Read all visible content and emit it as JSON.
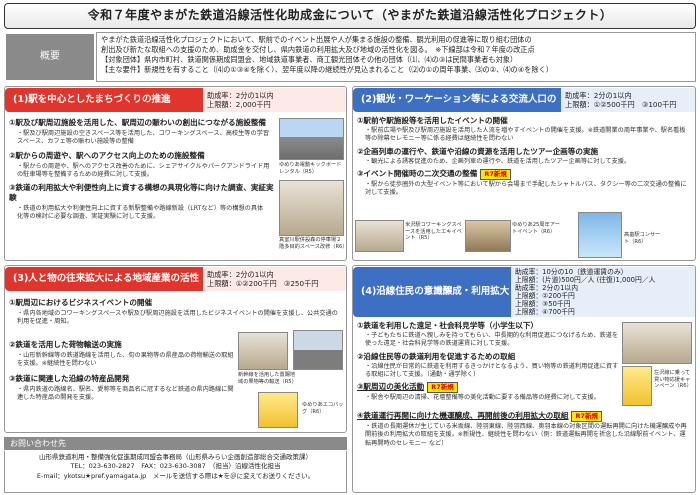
{
  "title": "令和７年度やまがた鉄道沿線活性化助成金について（やまがた鉄道沿線活性化プロジェクト）",
  "overview": {
    "label": "概要",
    "lines": [
      "やまがた鉄道沿線活性化プロジェクトにおいて、駅前でのイベント出展や人が集まる施設の整備、観光利用の促進等に取り組む団体の",
      "創出及び新たな取組への支援のため、助成金を交付し、県内鉄道の利用拡大及び地域の活性化を図る。　※下線部は令和７年度の改正点",
      "【対象団体】県内市町村、鉄道関係期成同盟会、地域鉄道事業者、商工観光団体その他の団体（⑴、⑷の③は民間事業者も対象）",
      "【主な要件】新規性を有すること（⑷の①③④を除く）、翌年度以降の継続性が見込まれること（⑵の①の周年事業、⑶の②、⑷の④を除く）"
    ]
  },
  "panel1": {
    "header": "(1)駅を中心としたまちづくりの推進",
    "stat1": "助成率：2分の1以内",
    "stat2": "上限額：2,000千円",
    "items": [
      {
        "title": "①駅及び駅周辺施設を活用した、駅周辺の賑わいの創出につながる施設整備",
        "desc": "・駅及び駅周辺施設の空きスペース等を活用した、コワーキングスペース、高校生等の学習スペース、カフェ等の賑わい施設等の整備"
      },
      {
        "title": "②駅からの周遊や、駅へのアクセス向上のための施設整備",
        "desc": "・駅からの周遊や、駅へのアクセス改善のために、シェアサイクルやパークアンドライド用の駐車場等を整備するための経費に対して支援。"
      },
      {
        "title": "③鉄道の利用拡大や利便性向上に資する構想の具現化等に向けた調査、実証実験",
        "desc": "・鉄道の利用拡大や利便性向上に資する新駅整備や路線新設（LRTなど）等の構想の具体化等の検討に必要な調査、実証実験に対して支援。"
      }
    ],
    "captions": [
      "ゆめりあ電動キックボードレンタル（R5）",
      "真室川駅併設森の停車場２階多目的スペース改修（R6）"
    ]
  },
  "panel2": {
    "header": "(2)観光・ワーケーション等による交流人口の拡大",
    "stat1": "助成率：2分の1以内",
    "stat2": "上限額：①②500千円　③100千円",
    "items": [
      {
        "title": "①駅前や駅施設等を活用したイベントの開催",
        "desc": "・駅前広場や駅及び駅周辺施設を活用した人流を増やすイベントの開催を支援。※鉄道開業の周年事業や、駅名看板等の除幕セレモニー等に係る経費は継続性を問わない"
      },
      {
        "title": "②企画列車の運行や、鉄道や沿線の資源を活用したツアー企画等の実施",
        "desc": "・観光による誘客促進のため、企画列車の運行や、鉄道を活用したツアー企画等に対して支援。"
      },
      {
        "title": "③イベント開催時の二次交通の整備",
        "tag": "R7新規",
        "desc": "・駅から徒歩圏外の大型イベント等において駅から会場まで手配したシャトルバス、タクシー等の二次交通の整備に対して支援。"
      }
    ],
    "captions": [
      "米沢駅コワーキングスペースを活用したエキイベント（R5）",
      "ゆめりあ25周年アートイベント（R6）",
      "高畠駅コンサート（R6）"
    ]
  },
  "panel3": {
    "header": "(3)人と物の往来拡大による地域産業の活性化",
    "stat1": "助成率：2分の1以内",
    "stat2": "上限額：①②200千円　③250千円",
    "items": [
      {
        "title": "①駅周辺におけるビジネスイベントの開催",
        "desc": "・県内各地域のコワーキングスペースや駅及び駅周辺施設を活用したビジネスイベントの開催を支援し、公共交通の利用を促進・周知。"
      },
      {
        "title": "②鉄道を活用した荷物輸送の実施",
        "desc": "・山形新幹線等の鉄道路線を活用した、旬の果物等の県産品の荷物輸送の取組を支援。※継続性を問わない"
      },
      {
        "title": "③鉄道に関連した沿線の特産品開発",
        "desc": "・県内鉄道の路線名、駅名、愛称等を商品名に冠するなど鉄道の県内路線に関連した特産品の開発を支援。"
      }
    ],
    "captions": [
      "新幹線を活用した置賜地域の果物等の輸送（R5）",
      "ゆめりあエコバッグ（R6）"
    ]
  },
  "panel4": {
    "header": "(4)沿線住民の意識醸成・利用拡大",
    "stats": [
      "助成率：10分の10（鉄道運賃のみ）",
      "上限額：(片道)500円／人 (往復)1,000円／人",
      "助成率：2分の1以内",
      "上限額：②200千円",
      "上限額：③50千円",
      "上限額：④700千円"
    ],
    "items": [
      {
        "title": "①鉄道を利用した遠足・社会科見学等（小学生以下）",
        "desc": "・子どもたちに鉄道へ親しみを持ってもらい、中長期的な利用促進につなげるため、鉄道を使った遠足・社会科見学等の鉄道運賃に対して支援。"
      },
      {
        "title": "②沿線住民等の鉄道利用を促進するための取組",
        "desc": "・沿線住民が日常的に鉄道を利用するきっかけとなるよう、買い物等の鉄道利用促進に資する取組に対して支援。（通勤・通学除く）"
      },
      {
        "title": "③駅周辺の美化活動",
        "tag": "R7新規",
        "desc": "・駅舎や駅周辺の清掃、花壇整備等の美化活動に要する備品等の経費に対して支援。"
      },
      {
        "title": "④鉄道運行再開に向けた機運醸成、再開前後の利用拡大の取組",
        "tag": "R7新規",
        "desc": "・鉄道の長期運休が生じている米坂線、陸羽東線、陸羽西線、奥羽本線の対象区間の運転再開に向けた機運醸成や再開前後の利用拡大の取組を支援。※新規性、継続性を問わない（例：鉄道運転再開を祈念した沿線駅前イベント、運転再開時のセレモニー など）"
      }
    ],
    "captions": [
      "左沢線に乗って買い物応援キャンペーン（R6）"
    ]
  },
  "contact": {
    "header": "お問い合わせ先",
    "lines": [
      "山形県鉄道利用・整備強化促進期成同盟会事務局（山形県みらい企画創造部総合交通政策課）",
      "TEL：023-630-2827　FAX：023-630-3087　（担当）沿線活性化担当",
      "E-mail：ykotsu★pref.yamagata.jp　メールを送信する際は★を＠に変えてお送りください。"
    ]
  },
  "colors": {
    "red": "#e0352c",
    "blue": "#3d6fc2",
    "gray": "#8a8a8a",
    "tag_yellow": "#ffe600"
  }
}
